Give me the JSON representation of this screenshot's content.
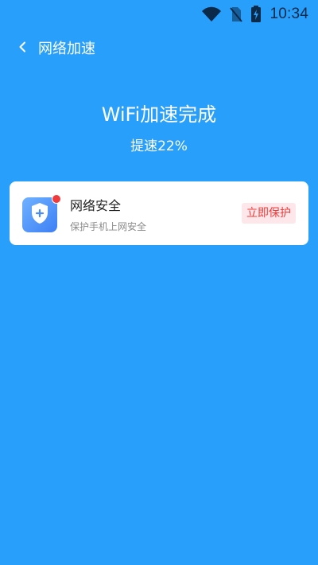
{
  "status_bar": {
    "time": "10:34",
    "icons": [
      "wifi-icon",
      "no-sim-icon",
      "battery-charging-icon"
    ]
  },
  "toolbar": {
    "back_icon": "chevron-left-icon",
    "title": "网络加速"
  },
  "result": {
    "title": "WiFi加速完成",
    "subtitle": "提速22%"
  },
  "feature_card": {
    "icon": "shield-plus-icon",
    "title": "网络安全",
    "description": "保护手机上网安全",
    "action_label": "立即保护"
  },
  "colors": {
    "background": "#289ffb",
    "card": "#ffffff",
    "accent_red": "#ef3b3b",
    "button_bg": "#fde7ea",
    "status_icon": "#0b2a4a"
  }
}
